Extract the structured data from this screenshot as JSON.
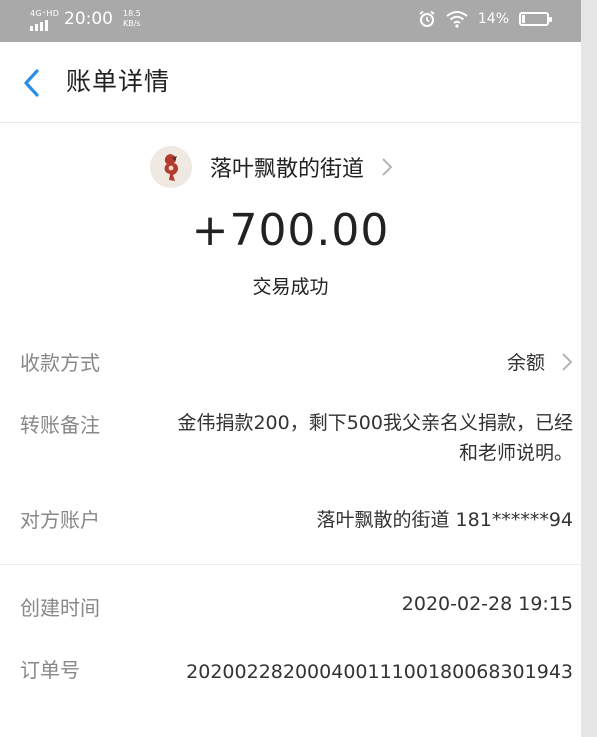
{
  "status_bar": {
    "network": "4G⁺HD",
    "time": "20:00",
    "speed": "18.5",
    "speed_unit": "KB/s",
    "battery": "14%"
  },
  "nav": {
    "title": "账单详情"
  },
  "payee": {
    "name": "落叶飘散的街道"
  },
  "amount": "+700.00",
  "status": "交易成功",
  "details": {
    "payment_method": {
      "label": "收款方式",
      "value": "余额"
    },
    "memo": {
      "label": "转账备注",
      "value": "金伟捐款200，剩下500我父亲名义捐款，已经和老师说明。"
    },
    "counterparty": {
      "label": "对方账户",
      "value": "落叶飘散的街道 181******94"
    },
    "created": {
      "label": "创建时间",
      "value": "2020-02-28 19:15"
    },
    "order_no": {
      "label": "订单号",
      "value": "20200228200040011100180068301943"
    }
  }
}
